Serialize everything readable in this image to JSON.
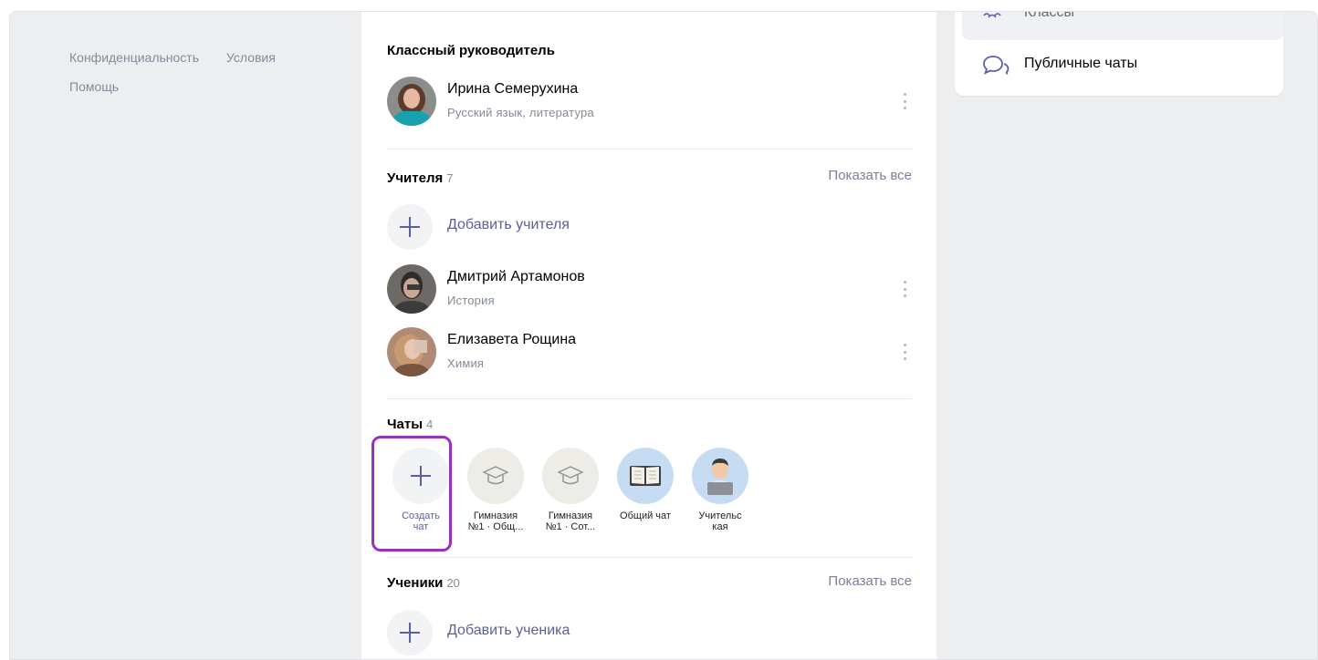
{
  "footer": {
    "privacy": "Конфиденциальность",
    "terms": "Условия",
    "help": "Помощь"
  },
  "class_teacher": {
    "section_title": "Классный руководитель",
    "name": "Ирина Семерухина",
    "subject": "Русский язык, литература"
  },
  "teachers": {
    "section_title": "Учителя",
    "count": "7",
    "show_all": "Показать все",
    "add_label": "Добавить учителя",
    "items": [
      {
        "name": "Дмитрий Артамонов",
        "subject": "История"
      },
      {
        "name": "Елизавета Рощина",
        "subject": "Химия"
      }
    ]
  },
  "chats": {
    "section_title": "Чаты",
    "count": "4",
    "create_line1": "Создать",
    "create_line2": "чат",
    "items": [
      {
        "line1": "Гимназия",
        "line2": "№1 · Общ..."
      },
      {
        "line1": "Гимназия",
        "line2": "№1 · Сот..."
      },
      {
        "line1": "Общий чат",
        "line2": ""
      },
      {
        "line1": "Учительс",
        "line2": "кая"
      }
    ]
  },
  "students": {
    "section_title": "Ученики",
    "count": "20",
    "show_all": "Показать все",
    "add_label": "Добавить ученика"
  },
  "right_menu": {
    "classes": "Классы",
    "public_chats": "Публичные чаты"
  },
  "colors": {
    "accent": "#5c5fa6",
    "highlight": "#9a2fc1",
    "background": "#edeef0"
  }
}
